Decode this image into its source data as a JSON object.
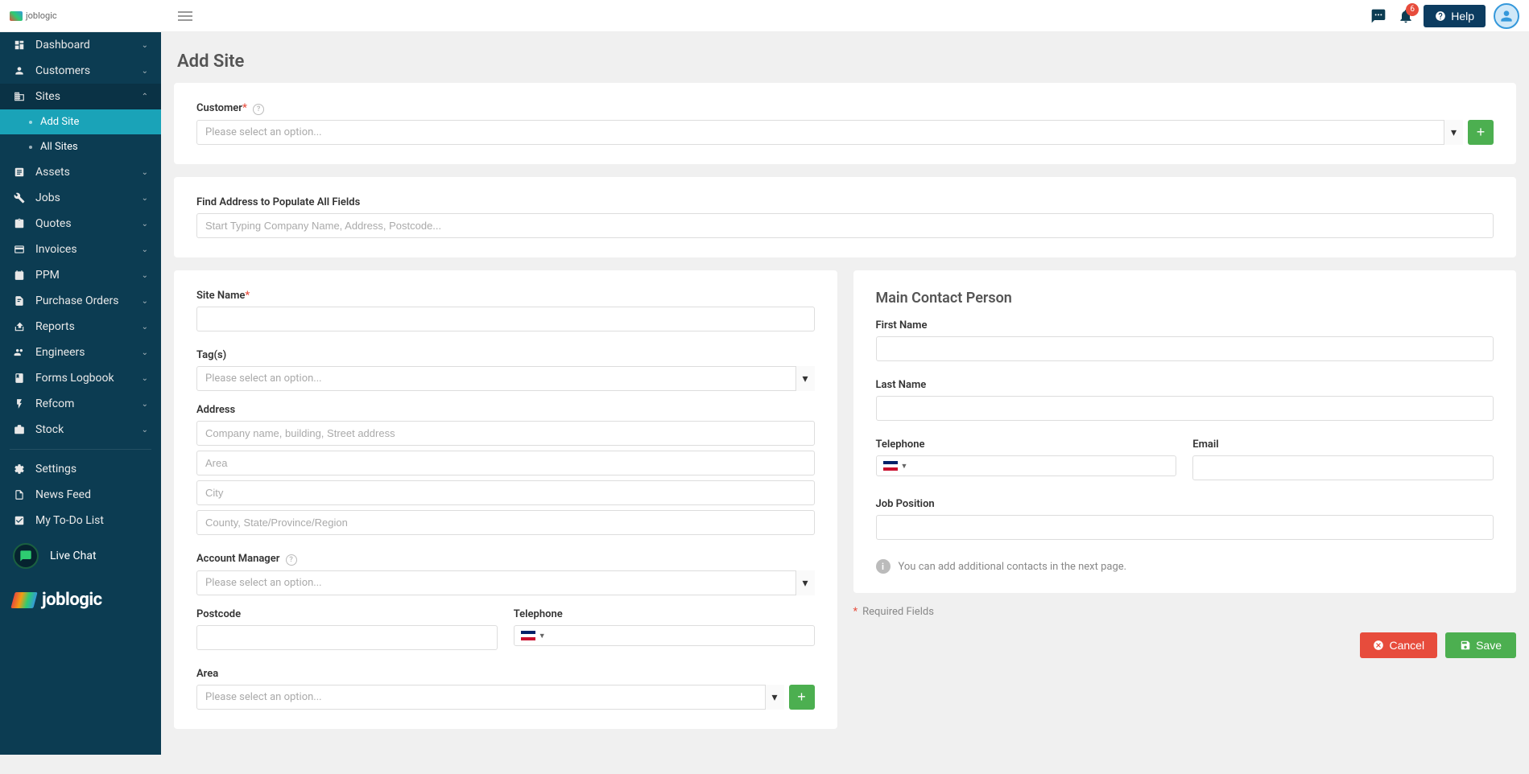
{
  "header": {
    "logo_text": "joblogic",
    "notif_count": "6",
    "help_label": "Help"
  },
  "sidebar": {
    "items": [
      {
        "label": "Dashboard",
        "icon": "dashboard"
      },
      {
        "label": "Customers",
        "icon": "customers"
      },
      {
        "label": "Sites",
        "icon": "sites",
        "expanded": true,
        "children": [
          {
            "label": "Add Site",
            "active": true
          },
          {
            "label": "All Sites"
          }
        ]
      },
      {
        "label": "Assets",
        "icon": "assets"
      },
      {
        "label": "Jobs",
        "icon": "jobs"
      },
      {
        "label": "Quotes",
        "icon": "quotes"
      },
      {
        "label": "Invoices",
        "icon": "invoices"
      },
      {
        "label": "PPM",
        "icon": "ppm"
      },
      {
        "label": "Purchase Orders",
        "icon": "po"
      },
      {
        "label": "Reports",
        "icon": "reports"
      },
      {
        "label": "Engineers",
        "icon": "engineers"
      },
      {
        "label": "Forms Logbook",
        "icon": "forms"
      },
      {
        "label": "Refcom",
        "icon": "refcom"
      },
      {
        "label": "Stock",
        "icon": "stock"
      }
    ],
    "secondary": [
      {
        "label": "Settings",
        "icon": "settings"
      },
      {
        "label": "News Feed",
        "icon": "news"
      },
      {
        "label": "My To-Do List",
        "icon": "todo"
      }
    ],
    "live_chat_label": "Live Chat",
    "footer_logo": "joblogic"
  },
  "page": {
    "title": "Add Site",
    "customer_label": "Customer",
    "customer_placeholder": "Please select an option...",
    "find_address_label": "Find Address to Populate All Fields",
    "find_address_placeholder": "Start Typing Company Name, Address, Postcode...",
    "site_name_label": "Site Name",
    "tags_label": "Tag(s)",
    "tags_placeholder": "Please select an option...",
    "address_label": "Address",
    "address_line1_placeholder": "Company name, building, Street address",
    "address_line2_placeholder": "Area",
    "address_line3_placeholder": "City",
    "address_line4_placeholder": "County, State/Province/Region",
    "account_manager_label": "Account Manager",
    "account_manager_placeholder": "Please select an option...",
    "postcode_label": "Postcode",
    "telephone_label": "Telephone",
    "area_label": "Area",
    "area_placeholder": "Please select an option...",
    "contact": {
      "title": "Main Contact Person",
      "first_name_label": "First Name",
      "last_name_label": "Last Name",
      "telephone_label": "Telephone",
      "email_label": "Email",
      "job_position_label": "Job Position",
      "info_text": "You can add additional contacts in the next page."
    },
    "required_note": "Required Fields",
    "cancel_label": "Cancel",
    "save_label": "Save"
  }
}
